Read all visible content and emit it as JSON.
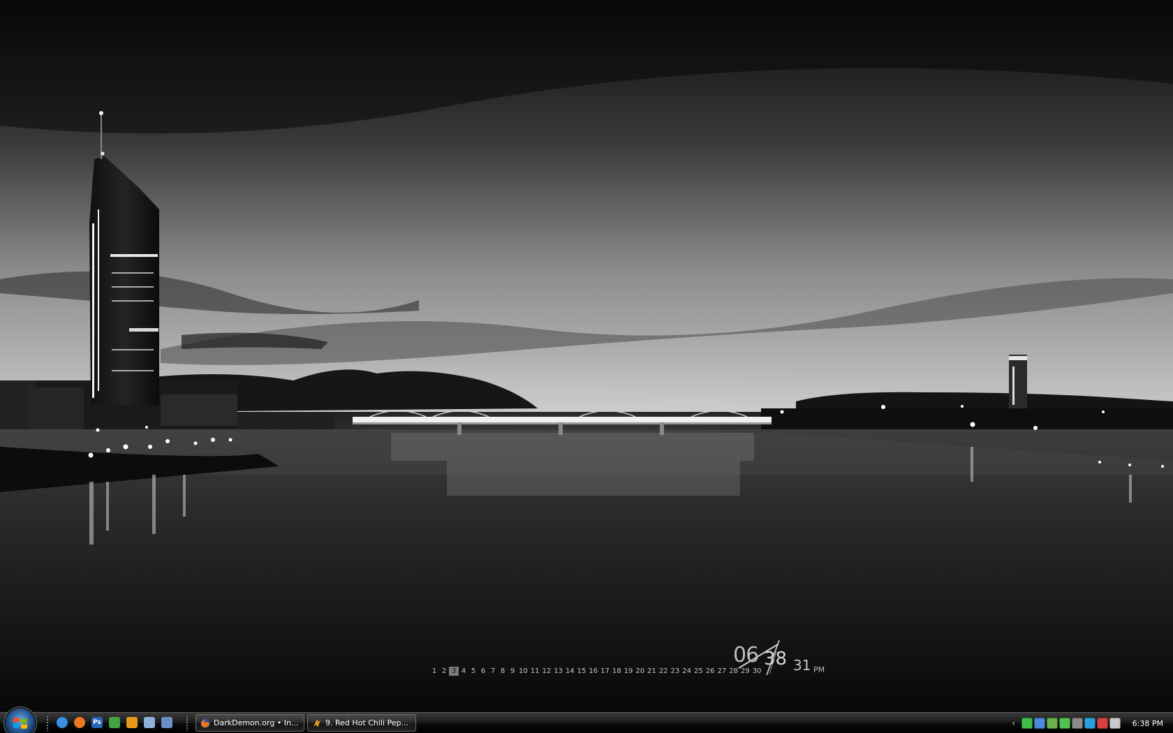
{
  "calendar": {
    "days": [
      "1",
      "2",
      "3",
      "4",
      "5",
      "6",
      "7",
      "8",
      "9",
      "10",
      "11",
      "12",
      "13",
      "14",
      "15",
      "16",
      "17",
      "18",
      "19",
      "20",
      "21",
      "22",
      "23",
      "24",
      "25",
      "26",
      "27",
      "28",
      "29",
      "30"
    ],
    "today": "3"
  },
  "clock": {
    "hours": "06",
    "minutes": "38",
    "seconds": "31",
    "ampm": "PM"
  },
  "taskbar": {
    "start_icon": "windows-logo-icon",
    "quick_launch": [
      {
        "name": "internet-explorer-icon",
        "color": "#3a8fe0"
      },
      {
        "name": "firefox-icon",
        "color": "#e87a1e"
      },
      {
        "name": "photoshop-icon",
        "color": "#2a63b8",
        "text": "Ps"
      },
      {
        "name": "messenger-icon",
        "color": "#3fa444"
      },
      {
        "name": "winamp-icon",
        "color": "#e69a1a"
      },
      {
        "name": "show-desktop-icon",
        "color": "#8fb0d8"
      },
      {
        "name": "switch-windows-icon",
        "color": "#6a8fc4"
      }
    ],
    "tasks": [
      {
        "label": "DarkDemon.org • In...",
        "icon": "firefox-icon",
        "icon_color": "#e87a1e"
      },
      {
        "label": "9. Red Hot Chili Pep...",
        "icon": "winamp-icon",
        "icon_color": "#e69a1a"
      }
    ],
    "tray": {
      "chevron": "‹",
      "icons": [
        {
          "name": "network-status-icon",
          "color": "#3fbf4a"
        },
        {
          "name": "bluetooth-icon",
          "color": "#4a8ad8"
        },
        {
          "name": "nvidia-icon",
          "color": "#6ab04c"
        },
        {
          "name": "green-app-icon",
          "color": "#52c252"
        },
        {
          "name": "security-icon",
          "color": "#8a8a8a"
        },
        {
          "name": "skype-icon",
          "color": "#2aa0e0"
        },
        {
          "name": "antivirus-icon",
          "color": "#d84040"
        },
        {
          "name": "volume-icon",
          "color": "#c8c8c8"
        }
      ],
      "time": "6:38 PM"
    }
  }
}
